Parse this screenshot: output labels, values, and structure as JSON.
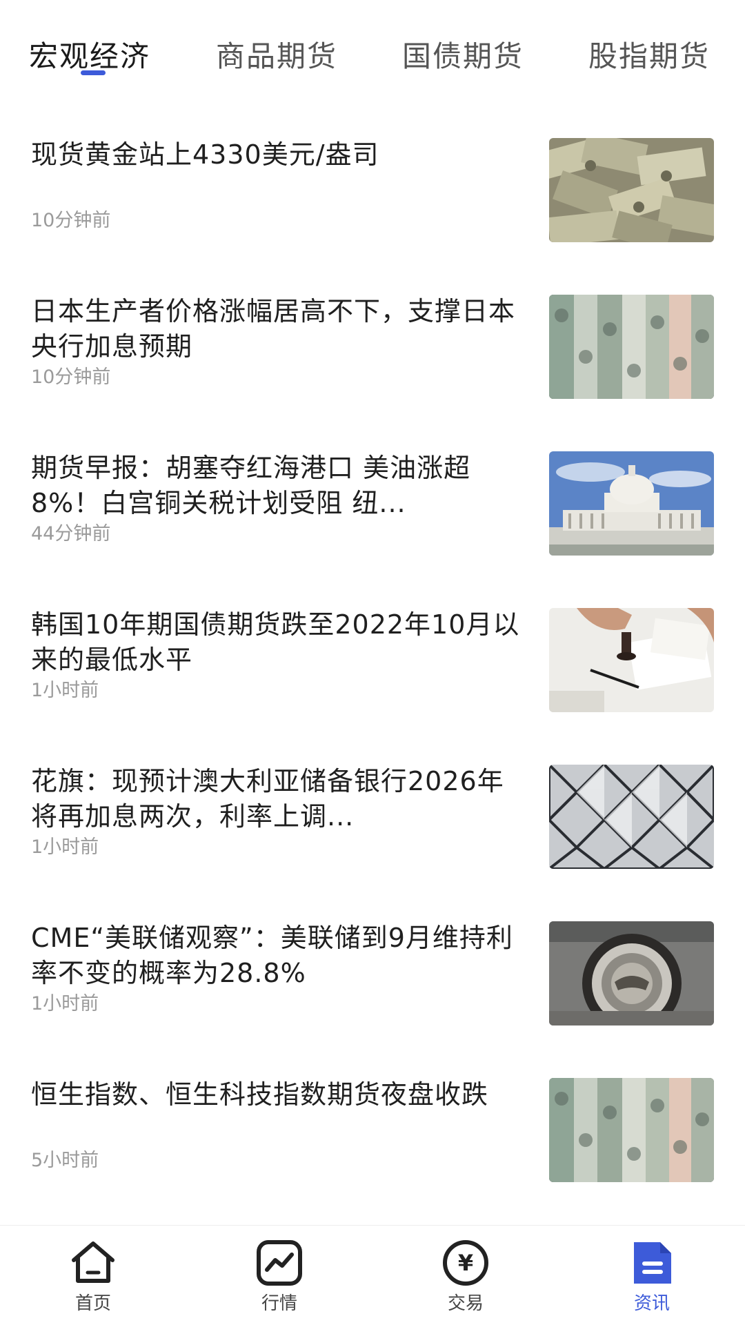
{
  "tabs": [
    {
      "label": "宏观经济",
      "active": true
    },
    {
      "label": "商品期货",
      "active": false
    },
    {
      "label": "国债期货",
      "active": false
    },
    {
      "label": "股指期货",
      "active": false
    }
  ],
  "news": [
    {
      "title": "现货黄金站上4330美元/盎司",
      "time": "10分钟前",
      "image": "cash-pile-image"
    },
    {
      "title": "日本生产者价格涨幅居高不下，支撑日本央行加息预期",
      "time": "10分钟前",
      "image": "rolled-dollars-image"
    },
    {
      "title": "期货早报：胡塞夺红海港口 美油涨超8%！白宫铜关税计划受阻 纽...",
      "time": "44分钟前",
      "image": "capitol-building-image"
    },
    {
      "title": "韩国10年期国债期货跌至2022年10月以来的最低水平",
      "time": "1小时前",
      "image": "stamp-document-image"
    },
    {
      "title": "花旗：现预计澳大利亚储备银行2026年将再加息两次，利率上调...",
      "time": "1小时前",
      "image": "geometric-pattern-image"
    },
    {
      "title": "CME“美联储观察”：美联储到9月维持利率不变的概率为28.8%",
      "time": "1小时前",
      "image": "federal-reserve-seal-image"
    },
    {
      "title": "恒生指数、恒生科技指数期货夜盘收跌",
      "time": "5小时前",
      "image": "rolled-dollars-image"
    }
  ],
  "bottom_nav": [
    {
      "label": "首页",
      "icon": "home-icon",
      "active": false
    },
    {
      "label": "行情",
      "icon": "chart-icon",
      "active": false
    },
    {
      "label": "交易",
      "icon": "yuan-icon",
      "active": false
    },
    {
      "label": "资讯",
      "icon": "document-icon",
      "active": true
    }
  ],
  "colors": {
    "accent": "#3d5bd9",
    "title_text": "#1f1f1f",
    "meta_text": "#9a9a9a",
    "tab_inactive": "#555555"
  }
}
